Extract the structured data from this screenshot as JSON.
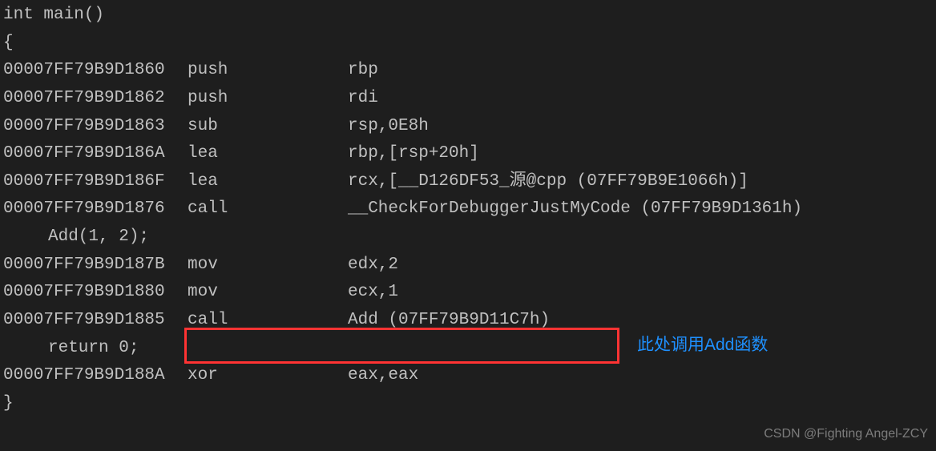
{
  "source": {
    "line0": "int main()",
    "line1": "{",
    "call_line": "Add(1, 2);",
    "return_line": "return 0;",
    "closing": "}"
  },
  "asm": {
    "l0": {
      "addr": "00007FF79B9D1860",
      "op": "push",
      "args": "rbp"
    },
    "l1": {
      "addr": "00007FF79B9D1862",
      "op": "push",
      "args": "rdi"
    },
    "l2": {
      "addr": "00007FF79B9D1863",
      "op": "sub",
      "args": "rsp,0E8h"
    },
    "l3": {
      "addr": "00007FF79B9D186A",
      "op": "lea",
      "args": "rbp,[rsp+20h]"
    },
    "l4": {
      "addr": "00007FF79B9D186F",
      "op": "lea",
      "args": "rcx,[__D126DF53_源@cpp (07FF79B9E1066h)]"
    },
    "l5": {
      "addr": "00007FF79B9D1876",
      "op": "call",
      "args": "__CheckForDebuggerJustMyCode (07FF79B9D1361h)"
    },
    "l6": {
      "addr": "00007FF79B9D187B",
      "op": "mov",
      "args": "edx,2"
    },
    "l7": {
      "addr": "00007FF79B9D1880",
      "op": "mov",
      "args": "ecx,1"
    },
    "l8": {
      "addr": "00007FF79B9D1885",
      "op": "call",
      "args": "Add (07FF79B9D11C7h)"
    },
    "l9": {
      "addr": "00007FF79B9D188A",
      "op": "xor",
      "args": "eax,eax"
    }
  },
  "annotation": "此处调用Add函数",
  "watermark": "CSDN @Fighting Angel-ZCY"
}
